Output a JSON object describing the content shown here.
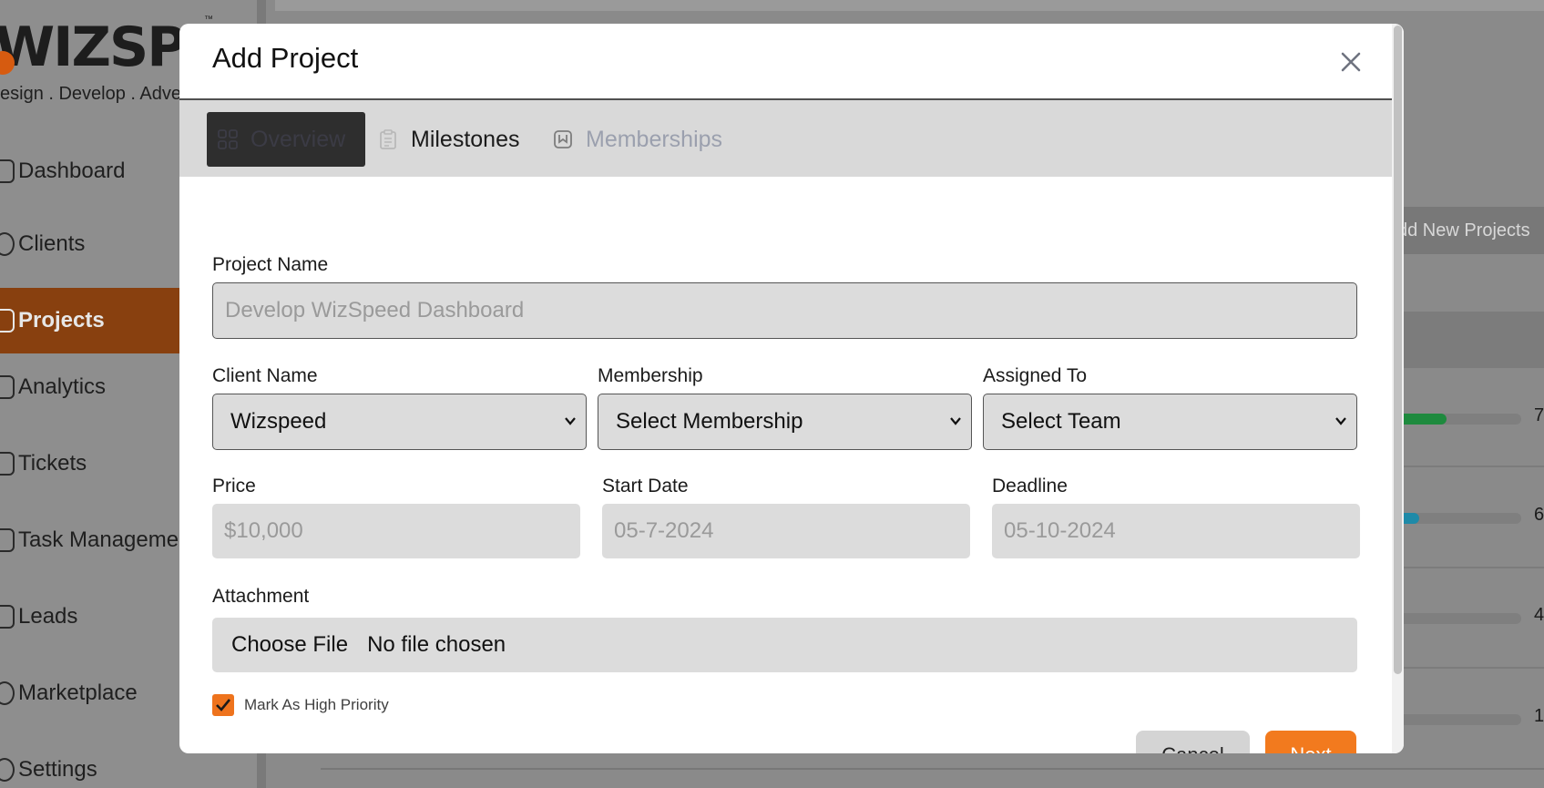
{
  "sidebar": {
    "logo_text": "WIZSPEED",
    "logo_tagline": "esign . Develop . Adve",
    "logo_tm": "™",
    "items": [
      {
        "label": "Dashboard"
      },
      {
        "label": "Clients"
      },
      {
        "label": "Projects",
        "active": true
      },
      {
        "label": "Analytics"
      },
      {
        "label": "Tickets"
      },
      {
        "label": "Task Manageme"
      },
      {
        "label": "Leads"
      },
      {
        "label": "Marketplace"
      },
      {
        "label": "Settings"
      }
    ]
  },
  "background": {
    "add_button_label": "dd New Projects",
    "progress_rows": [
      {
        "value": 0.45,
        "color": "#1e8a3e",
        "number": "7"
      },
      {
        "value": 0.25,
        "color": "#1f8aa8",
        "number": "6"
      },
      {
        "value": 0.0,
        "color": "#7f7f7f",
        "number": "4"
      },
      {
        "value": 0.0,
        "color": "#7f7f7f",
        "number": "1"
      }
    ]
  },
  "modal": {
    "title": "Add Project",
    "tabs": [
      {
        "label": "Overview",
        "icon": "grid-icon",
        "active": true
      },
      {
        "label": "Milestones",
        "icon": "clipboard-icon"
      },
      {
        "label": "Memberships",
        "icon": "bookmark-icon"
      }
    ],
    "fields": {
      "project_name": {
        "label": "Project Name",
        "placeholder": "Develop WizSpeed Dashboard"
      },
      "client_name": {
        "label": "Client Name",
        "value": "Wizspeed"
      },
      "membership": {
        "label": "Membership",
        "value": "Select Membership"
      },
      "assigned_to": {
        "label": "Assigned To",
        "value": "Select Team"
      },
      "price": {
        "label": "Price",
        "placeholder": "$10,000"
      },
      "start_date": {
        "label": "Start Date",
        "placeholder": "05-7-2024"
      },
      "deadline": {
        "label": "Deadline",
        "placeholder": "05-10-2024"
      },
      "attachment": {
        "label": "Attachment",
        "button": "Choose File",
        "status": "No file chosen"
      }
    },
    "high_priority": {
      "label": "Mark As High Priority",
      "checked": true
    },
    "cancel_label": "Cancel",
    "next_label": "Next"
  },
  "colors": {
    "accent": "#f27a1e",
    "active_nav": "#88400f",
    "overlay": "#8a8a8a"
  }
}
